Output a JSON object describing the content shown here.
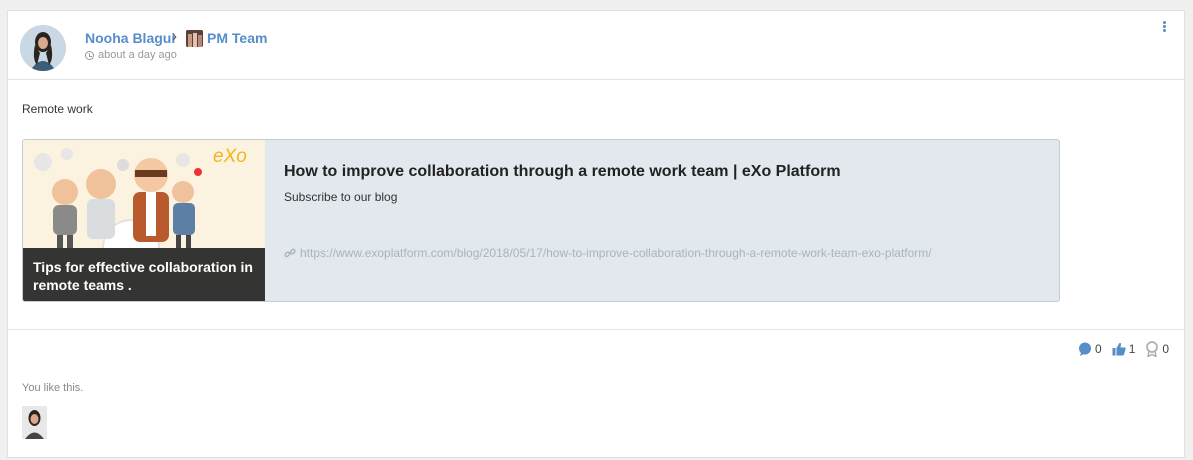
{
  "post": {
    "author_name": "Nooha Blagui",
    "separator": "›",
    "space_name": "PM Team",
    "timestamp": "about a day ago",
    "text": "Remote work"
  },
  "link_preview": {
    "title": "How to improve collaboration through a remote work team | eXo Platform",
    "description": "Subscribe to our blog",
    "url": "https://www.exoplatform.com/blog/2018/05/17/how-to-improve-collaboration-through-a-remote-work-team-exo-platform/",
    "image_caption": "Tips for effective collaboration in remote teams .",
    "image_logo": "eXo"
  },
  "reactions": {
    "comments": "0",
    "likes": "1",
    "kudos": "0"
  },
  "likes_summary": "You like this.",
  "colors": {
    "accent": "#578dc9",
    "link_card_bg": "#e2e8ee",
    "logo_yellow": "#f3b51d"
  },
  "icons": [
    "clock-icon",
    "more-vertical-icon",
    "link-icon",
    "comment-icon",
    "like-icon",
    "kudos-icon"
  ]
}
